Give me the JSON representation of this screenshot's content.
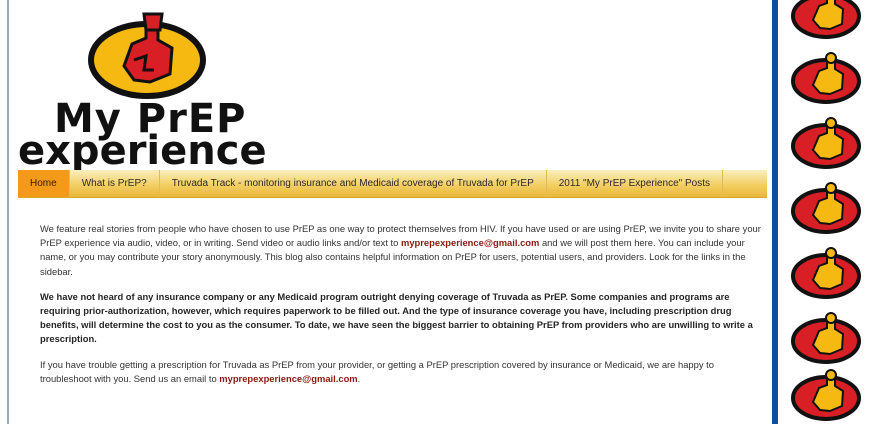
{
  "logo": {
    "line1": "My PrEP",
    "line2": "experience",
    "icon": "prep-person-logo-icon"
  },
  "nav": {
    "items": [
      {
        "label": "Home",
        "active": true
      },
      {
        "label": "What is PrEP?",
        "active": false
      },
      {
        "label": "Truvada Track - monitoring insurance and Medicaid coverage of Truvada for PrEP",
        "active": false
      },
      {
        "label": "2011 \"My PrEP Experience\" Posts",
        "active": false
      }
    ]
  },
  "content": {
    "p1_text_a": "We feature real stories from people who have chosen to use PrEP as one way to protect themselves from HIV. If you have used or are using PrEP, we invite you to share your PrEP experience via audio, video, or in writing. Send video or audio links and/or text to ",
    "p1_email": "myprepexperience@gmail.com",
    "p1_text_b": " and we will post them here. You can include your name, or you may contribute your story anonymously. This blog also contains helpful information on PrEP for users, potential users, and providers. Look for the links in the sidebar.",
    "p2": "We have not heard of any insurance company or any Medicaid program outright denying coverage of Truvada as PrEP. Some companies and programs are requiring prior-authorization, however, which requires paperwork to be filled out. And the type of insurance coverage you have, including prescription drug benefits, will determine the cost to you as the consumer. To date, we have seen the biggest barrier to obtaining PrEP from providers who are unwilling to write a prescription.",
    "p3_text_a": "If you have trouble getting a prescription for Truvada as PrEP from your provider, or getting a PrEP prescription covered by insurance or Medicaid, we are happy to troubleshoot with you. Send us an email to ",
    "p3_email": "myprepexperience@gmail.com",
    "p3_text_b": "."
  },
  "sidebar": {
    "icon": "prep-person-badge-icon",
    "badge_count": 7
  },
  "colors": {
    "brand_red": "#d91f26",
    "brand_yellow": "#f6b912",
    "nav_active": "#f39a1b",
    "sidebar_bar": "#0f4fa3",
    "email_link": "#8b1a0f"
  }
}
